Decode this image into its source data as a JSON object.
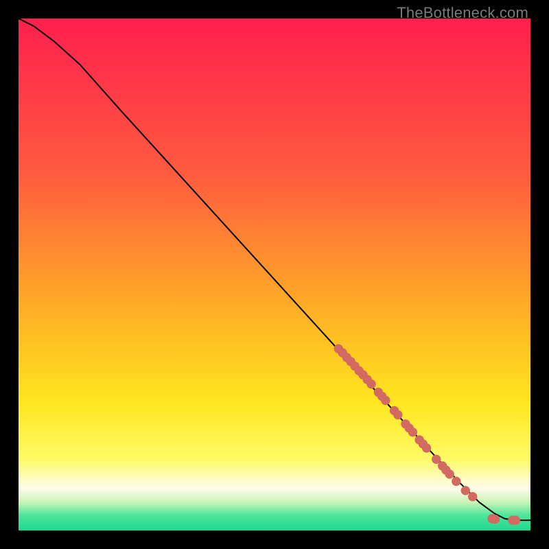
{
  "watermark": "TheBottleneck.com",
  "chart_data": {
    "type": "line",
    "title": "",
    "xlabel": "",
    "ylabel": "",
    "xlim": [
      0,
      100
    ],
    "ylim": [
      0,
      100
    ],
    "grid": false,
    "legend": false,
    "curve": {
      "name": "bottleneck-curve",
      "x": [
        0,
        3,
        7,
        12,
        20,
        30,
        40,
        50,
        60,
        70,
        80,
        86,
        90,
        93,
        95,
        97,
        100
      ],
      "y": [
        100,
        98.5,
        95.5,
        91,
        82,
        71,
        60,
        49,
        38,
        27,
        16,
        9.5,
        5.5,
        3.3,
        2.3,
        2,
        2
      ]
    },
    "points": {
      "name": "devices",
      "color": "#d36a62",
      "radius_pct": 0.9,
      "xy": [
        [
          62.5,
          35.5
        ],
        [
          63.3,
          34.7
        ],
        [
          64.1,
          33.8
        ],
        [
          64.9,
          33.0
        ],
        [
          65.7,
          32.1
        ],
        [
          66.5,
          31.2
        ],
        [
          67.3,
          30.4
        ],
        [
          68.1,
          29.5
        ],
        [
          68.9,
          28.6
        ],
        [
          70.3,
          27.0
        ],
        [
          71.0,
          26.2
        ],
        [
          71.7,
          25.4
        ],
        [
          73.4,
          23.4
        ],
        [
          74.1,
          22.6
        ],
        [
          75.6,
          20.8
        ],
        [
          76.3,
          20.0
        ],
        [
          77.0,
          19.2
        ],
        [
          78.3,
          17.7
        ],
        [
          79.0,
          16.9
        ],
        [
          79.7,
          16.1
        ],
        [
          81.6,
          13.9
        ],
        [
          82.8,
          12.6
        ],
        [
          83.5,
          11.8
        ],
        [
          84.2,
          11.0
        ],
        [
          85.5,
          9.6
        ],
        [
          87.3,
          7.8
        ],
        [
          88.7,
          6.6
        ],
        [
          92.5,
          2.3
        ],
        [
          93.1,
          2.2
        ],
        [
          96.5,
          2.0
        ],
        [
          97.1,
          2.0
        ]
      ]
    },
    "background_gradient": {
      "stops": [
        {
          "offset": 0.0,
          "color": "#ff1f4e"
        },
        {
          "offset": 0.3,
          "color": "#ff5a3f"
        },
        {
          "offset": 0.58,
          "color": "#ffb224"
        },
        {
          "offset": 0.75,
          "color": "#ffe61e"
        },
        {
          "offset": 0.86,
          "color": "#fffb66"
        },
        {
          "offset": 0.918,
          "color": "#fdfceb"
        },
        {
          "offset": 0.945,
          "color": "#c9f4b4"
        },
        {
          "offset": 0.97,
          "color": "#4ee59a"
        },
        {
          "offset": 1.0,
          "color": "#1ed990"
        }
      ]
    }
  }
}
